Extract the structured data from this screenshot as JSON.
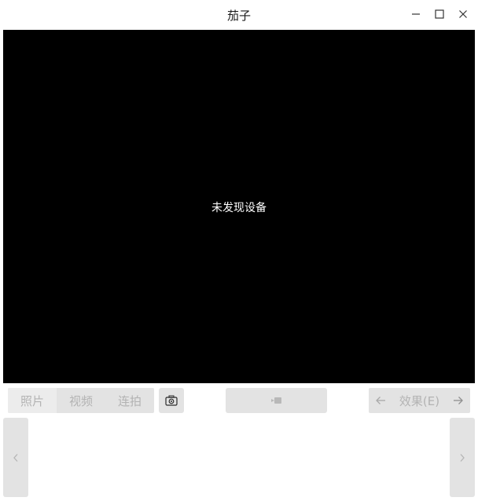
{
  "window": {
    "title": "茄子",
    "controls": [
      "minimize-icon",
      "maximize-icon",
      "close-icon"
    ]
  },
  "viewport": {
    "message": "未发现设备"
  },
  "mode_tabs": [
    {
      "label": "照片",
      "active": true
    },
    {
      "label": "视频",
      "active": false
    },
    {
      "label": "连拍",
      "active": false
    }
  ],
  "toolbar": {
    "camera_icon": "camera-icon",
    "shutter_icon": "video-record-icon",
    "effects_label": "效果(E)",
    "prev_icon": "arrow-left-icon",
    "next_icon": "arrow-right-icon"
  },
  "thumbnail_strip": {
    "prev_icon": "chevron-left-icon",
    "next_icon": "chevron-right-icon"
  },
  "colors": {
    "viewport_bg": "#000000",
    "control_bg": "#e3e3e3",
    "disabled_text": "#b3b3b3"
  }
}
